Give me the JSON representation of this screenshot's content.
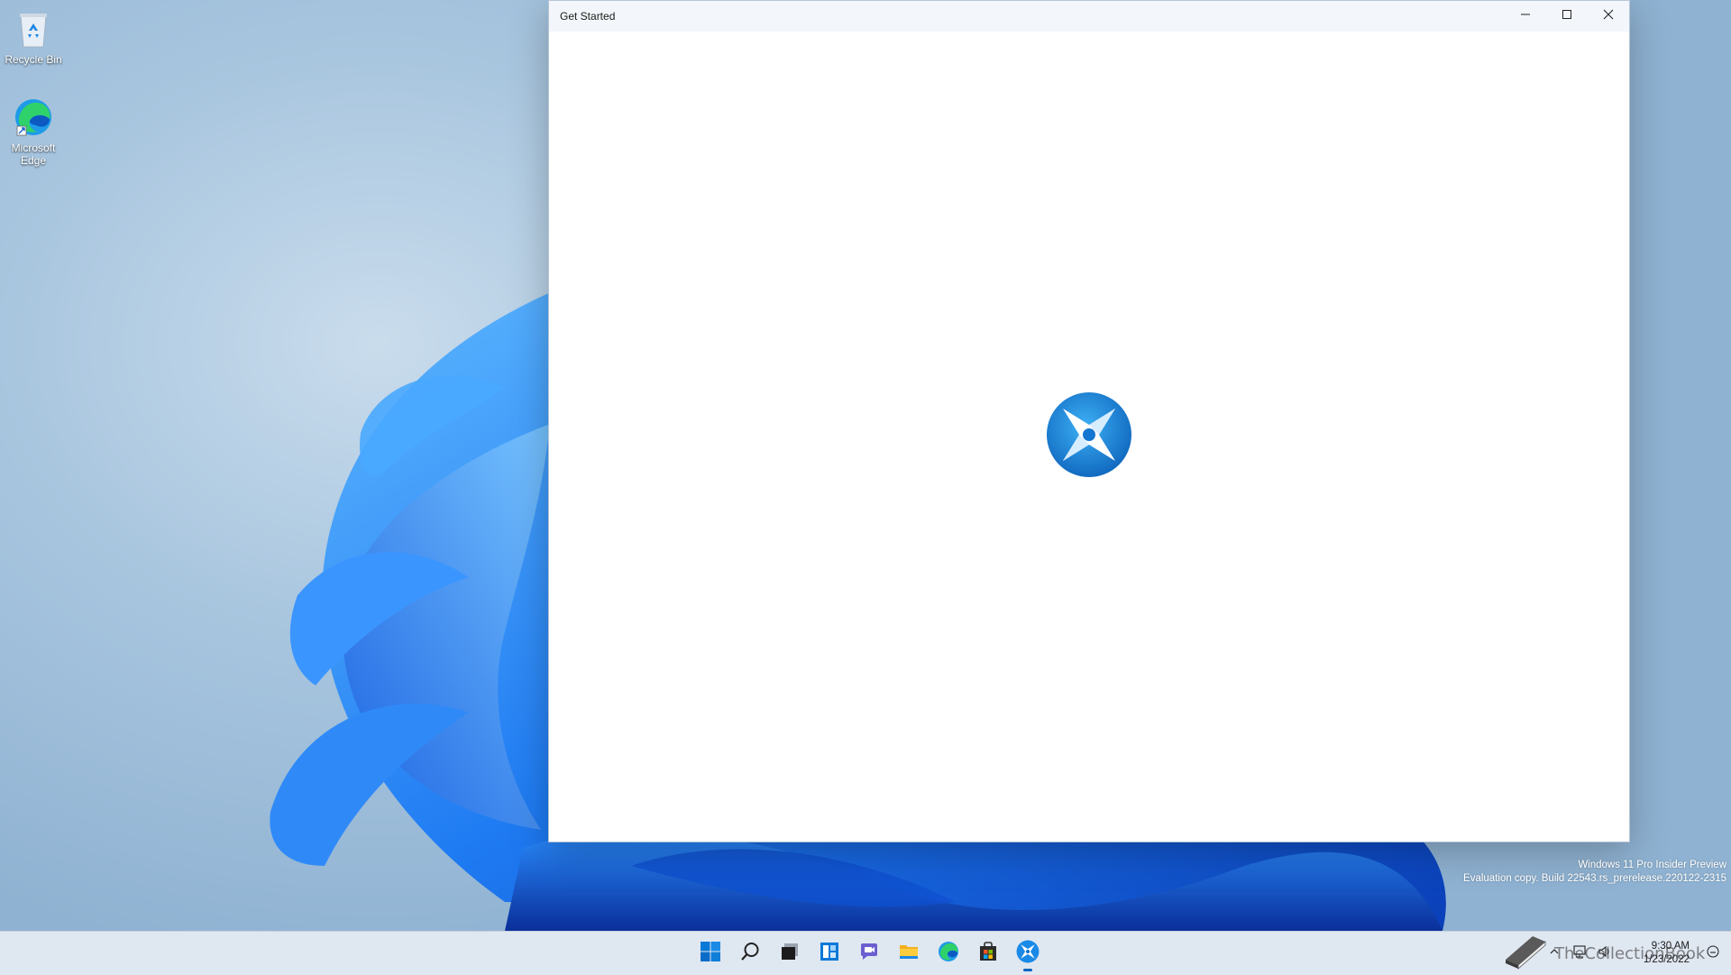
{
  "desktop": {
    "icons": [
      {
        "label": "Recycle Bin",
        "icon": "recycle-bin-icon"
      },
      {
        "label": "Microsoft Edge",
        "icon": "edge-icon"
      }
    ]
  },
  "window": {
    "title": "Get Started",
    "buttons": {
      "minimize": "minimize-icon",
      "maximize": "maximize-icon",
      "close": "close-icon"
    },
    "content_icon": "get-started-logo-icon"
  },
  "watermark": {
    "line1": "Windows 11 Pro Insider Preview",
    "line2": "Evaluation copy. Build 22543.rs_prerelease.220122-2315"
  },
  "taskbar": {
    "apps": [
      {
        "name": "start",
        "icon": "windows-start-icon"
      },
      {
        "name": "search",
        "icon": "search-icon"
      },
      {
        "name": "task-view",
        "icon": "task-view-icon"
      },
      {
        "name": "widgets",
        "icon": "widgets-icon"
      },
      {
        "name": "chat",
        "icon": "teams-chat-icon"
      },
      {
        "name": "file-explorer",
        "icon": "folder-icon"
      },
      {
        "name": "edge",
        "icon": "edge-icon"
      },
      {
        "name": "store",
        "icon": "store-icon"
      },
      {
        "name": "get-started",
        "icon": "get-started-icon",
        "active": true
      }
    ],
    "tray": {
      "overlay_text": "TheCollectionBook",
      "time": "9:30 AM",
      "date": "1/23/2022"
    }
  },
  "colors": {
    "accent": "#0a66c2",
    "wallpaper_blue": "#1a6cf0",
    "taskbar_bg": "#dfe7f1"
  }
}
